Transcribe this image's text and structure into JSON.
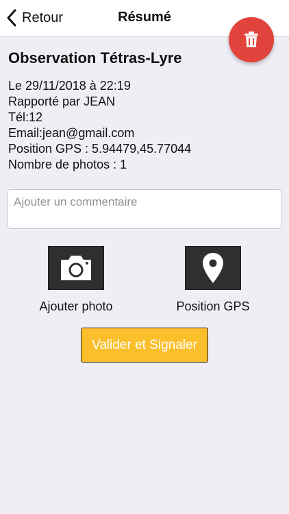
{
  "navbar": {
    "back_label": "Retour",
    "title": "Résumé"
  },
  "observation": {
    "title": "Observation Tétras-Lyre",
    "date_line": "Le 29/11/2018 à 22:19",
    "reporter_line": "Rapporté par JEAN",
    "phone_line": "Tél:12",
    "email_line": "Email:jean@gmail.com",
    "gps_line": "Position GPS : 5.94479,45.77044",
    "photos_line": "Nombre de photos : 1"
  },
  "comment": {
    "value": "",
    "placeholder": "Ajouter un commentaire"
  },
  "actions": {
    "add_photo_label": "Ajouter photo",
    "gps_label": "Position GPS"
  },
  "submit_label": "Valider et Signaler",
  "colors": {
    "background": "#efeef5",
    "delete_fab": "#e2433c",
    "submit": "#fbbf2c",
    "icon_tile": "#2f2f2f"
  },
  "icons": [
    "chevron-left-icon",
    "trash-icon",
    "camera-icon",
    "map-pin-icon"
  ]
}
